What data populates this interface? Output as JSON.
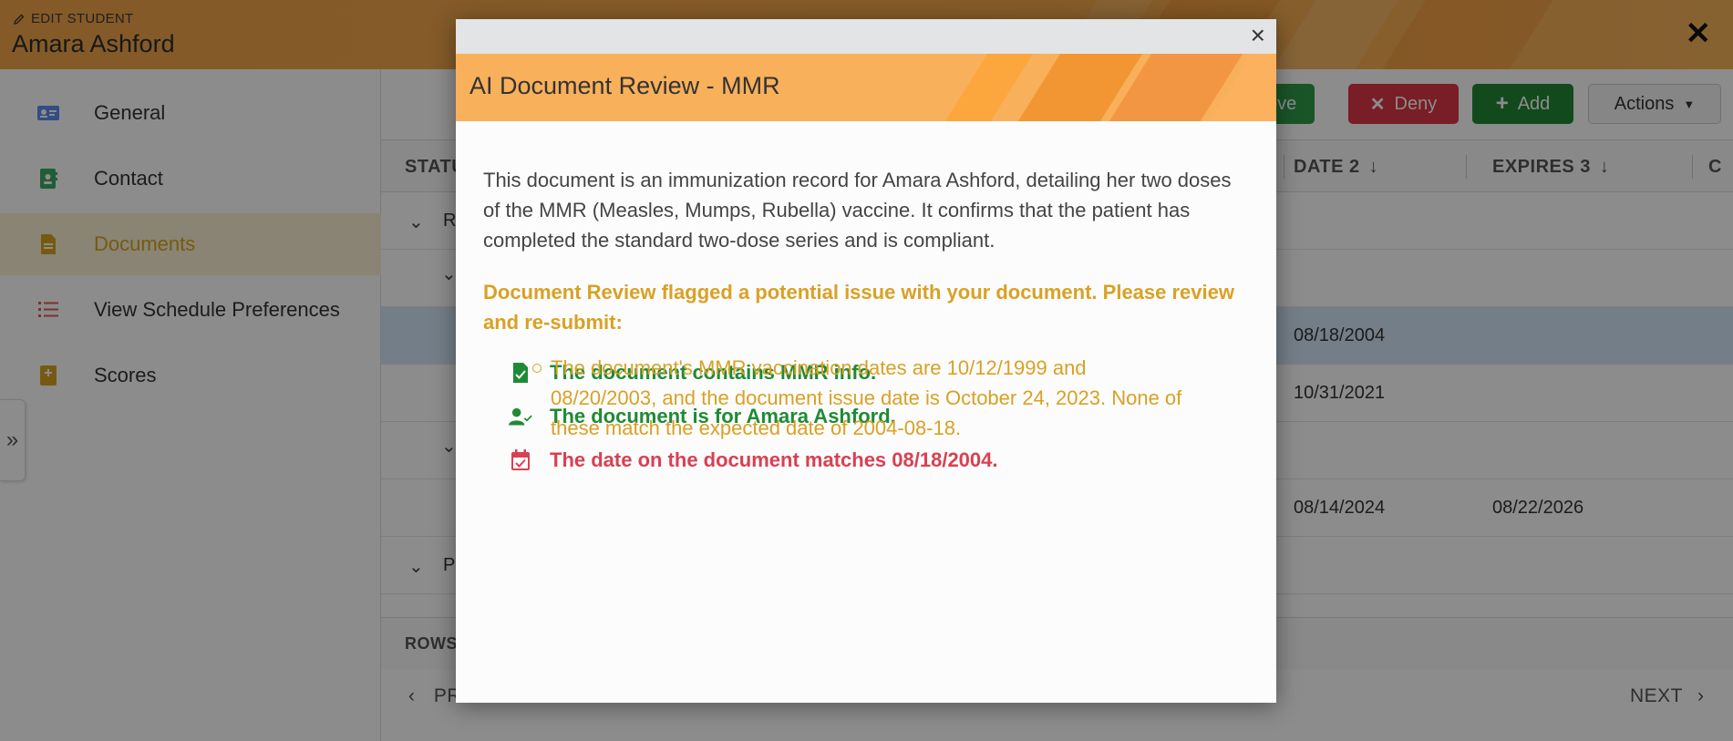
{
  "header": {
    "edit_label": "EDIT STUDENT",
    "student_name": "Amara Ashford",
    "close_glyph": "✕",
    "color": "#f0a54a"
  },
  "sidebar": {
    "items": [
      {
        "label": "General",
        "icon": "id-card-icon",
        "color": "#5b8def"
      },
      {
        "label": "Contact",
        "icon": "address-book-icon",
        "color": "#3aaa6a"
      },
      {
        "label": "Documents",
        "icon": "file-icon",
        "color": "#d9a41f",
        "active": true
      },
      {
        "label": "View Schedule Preferences",
        "icon": "list-icon",
        "color": "#e05a5a"
      },
      {
        "label": "Scores",
        "icon": "book-icon",
        "color": "#d9a41f"
      }
    ],
    "collapse_glyph": "»"
  },
  "main": {
    "toolbar": {
      "approve_label": "Approve",
      "deny_label": "Deny",
      "add_label": "Add",
      "actions_label": "Actions"
    },
    "table": {
      "columns": [
        "STATUS",
        "DATE 2",
        "EXPIRES 3",
        "C"
      ],
      "group_r": "R",
      "group_p": "P",
      "rows": [
        {
          "date": "08/18/2004",
          "expires": ""
        },
        {
          "date": "10/31/2021",
          "expires": ""
        },
        {
          "date": "08/14/2024",
          "expires": "08/22/2026"
        }
      ],
      "rows_label": "ROWS",
      "prev_label": "PREV",
      "next_label": "NEXT"
    }
  },
  "modal": {
    "close_glyph": "×",
    "title": "AI Document Review - MMR",
    "summary": "This document is an immunization record for Amara Ashford, detailing her two doses of the MMR (Measles, Mumps, Rubella) vaccine. It confirms that the patient has completed the standard two-dose series and is compliant.",
    "warning": "Document Review flagged a potential issue with your document. Please review and re-submit:",
    "checks": [
      {
        "label": "The document contains MMR info.",
        "status": "pass",
        "icon": "file-check-icon"
      },
      {
        "label": "The document is for Amara Ashford.",
        "status": "pass",
        "icon": "user-check-icon"
      },
      {
        "label": "The date on the document matches 08/18/2004.",
        "status": "fail",
        "icon": "calendar-check-icon"
      }
    ],
    "detail": "The document's MMR vaccination dates are 10/12/1999 and 08/20/2003, and the document issue date is October 24, 2023. None of these match the expected date of 2004-08-18.",
    "colors": {
      "pass": "#1f8a36",
      "fail": "#d94052",
      "warning": "#d9a124",
      "title_bar": "#f9b05a"
    }
  }
}
